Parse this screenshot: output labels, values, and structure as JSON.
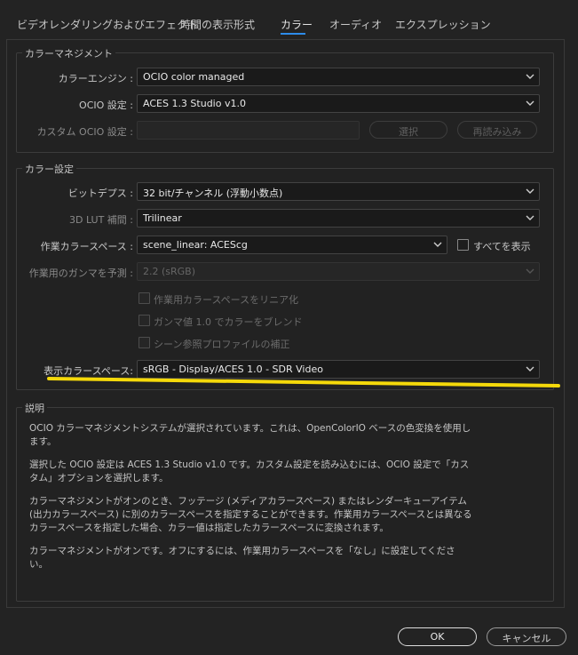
{
  "tabs": [
    {
      "label": "ビデオレンダリングおよびエフェクト"
    },
    {
      "label": "時間の表示形式"
    },
    {
      "label": "カラー"
    },
    {
      "label": "オーディオ"
    },
    {
      "label": "エクスプレッション"
    }
  ],
  "active_tab": "カラー",
  "color_management": {
    "title": "カラーマネジメント",
    "engine_label": "カラーエンジン :",
    "engine_value": "OCIO color managed",
    "ocio_label": "OCIO 設定 :",
    "ocio_value": "ACES 1.3 Studio v1.0",
    "custom_label": "カスタム OCIO 設定 :",
    "custom_value": "",
    "select_button": "選択",
    "reload_button": "再読み込み"
  },
  "color_settings": {
    "title": "カラー設定",
    "bit_depth_label": "ビットデプス :",
    "bit_depth_value": "32 bit/チャンネル (浮動小数点)",
    "lut_label": "3D LUT 補間 :",
    "lut_value": "Trilinear",
    "working_label": "作業カラースペース :",
    "working_value": "scene_linear: ACEScg",
    "show_all_label": "すべてを表示",
    "gamma_label": "作業用のガンマを予測 :",
    "gamma_value": "2.2 (sRGB)",
    "linearize_label": "作業用カラースペースをリニア化",
    "blend_label": "ガンマ値 1.0 でカラーをブレンド",
    "scene_label": "シーン参照プロファイルの補正",
    "display_label": "表示カラースペース:",
    "display_value": "sRGB - Display/ACES 1.0 - SDR Video"
  },
  "description": {
    "title": "説明",
    "para1": "OCIO カラーマネジメントシステムが選択されています。これは、OpenColorIO ベースの色変換を使用します。",
    "para2": "選択した OCIO 設定は ACES 1.3 Studio v1.0 です。カスタム設定を読み込むには、OCIO 設定で「カスタム」オプションを選択します。",
    "para3": "カラーマネジメントがオンのとき、フッテージ (メディアカラースペース) またはレンダーキューアイテム (出力カラースペース) に別のカラースペースを指定することができます。作業用カラースペースとは異なるカラースペースを指定した場合、カラー値は指定したカラースペースに変換されます。",
    "para4": "カラーマネジメントがオンです。オフにするには、作業用カラースペースを「なし」に設定してください。"
  },
  "footer": {
    "ok": "OK",
    "cancel": "キャンセル"
  },
  "colors": {
    "accent": "#2d8ceb",
    "highlight": "#f5d90a"
  }
}
